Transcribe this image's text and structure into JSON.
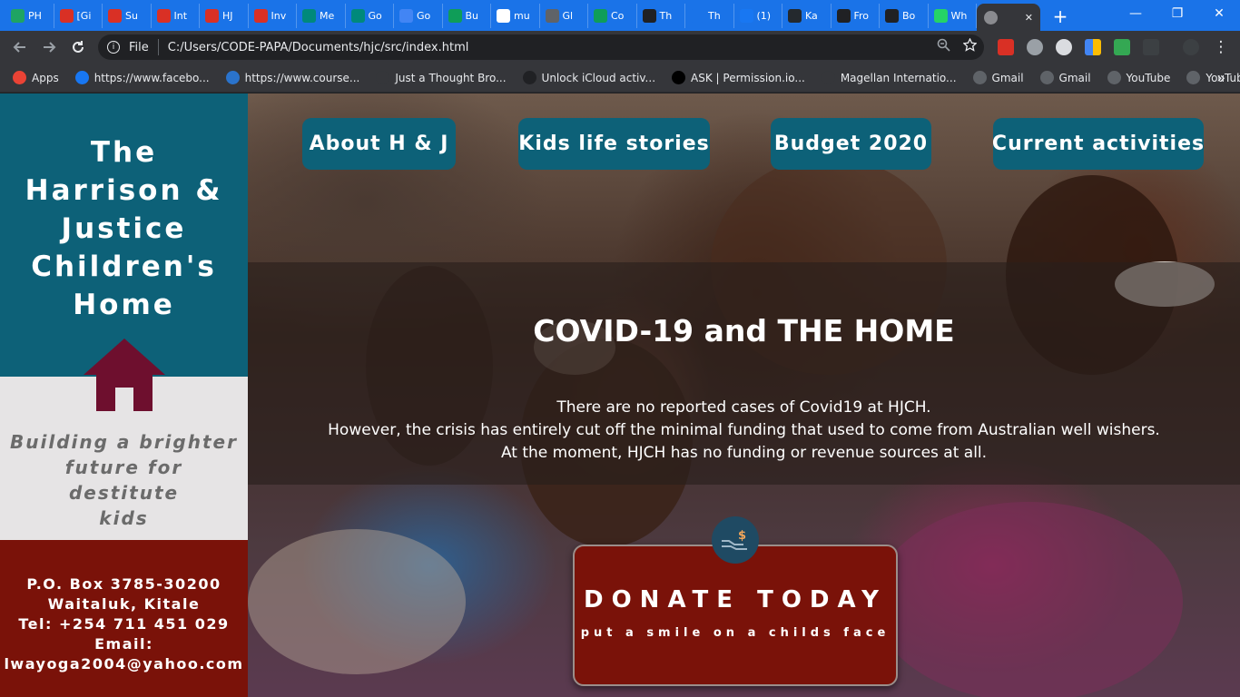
{
  "browser": {
    "tabs": [
      {
        "label": "PH",
        "icon": "sheets-icon",
        "color": "#1fa463"
      },
      {
        "label": "[Gi",
        "icon": "gmail-icon",
        "color": "#d93025"
      },
      {
        "label": "Su",
        "icon": "gmail-icon",
        "color": "#d93025"
      },
      {
        "label": "Int",
        "icon": "gmail-icon",
        "color": "#d93025"
      },
      {
        "label": "HJ",
        "icon": "gmail-icon",
        "color": "#d93025"
      },
      {
        "label": "Inv",
        "icon": "gmail-icon",
        "color": "#d93025"
      },
      {
        "label": "Me",
        "icon": "meet-icon",
        "color": "#00897b"
      },
      {
        "label": "Go",
        "icon": "meet-icon",
        "color": "#00897b"
      },
      {
        "label": "Go",
        "icon": "calendar-icon",
        "color": "#4285f4"
      },
      {
        "label": "Bu",
        "icon": "cross-icon",
        "color": "#0f9d58"
      },
      {
        "label": "mu",
        "icon": "google-icon",
        "color": "#ffffff"
      },
      {
        "label": "Gl",
        "icon": "bank-icon",
        "color": "#5f6368"
      },
      {
        "label": "Co",
        "icon": "cross-icon",
        "color": "#0f9d58"
      },
      {
        "label": "Th",
        "icon": "screen-icon",
        "color": "#202124"
      },
      {
        "label": "Th",
        "icon": "site-icon",
        "color": "#1a73e8"
      },
      {
        "label": "(1)",
        "icon": "facebook-icon",
        "color": "#1877f2"
      },
      {
        "label": "Ka",
        "icon": "github-icon",
        "color": "#24292e"
      },
      {
        "label": "Fro",
        "icon": "bolt-icon",
        "color": "#202124"
      },
      {
        "label": "Bo",
        "icon": "box-icon",
        "color": "#202124"
      },
      {
        "label": "Wh",
        "icon": "whatsapp-icon",
        "color": "#25d366"
      }
    ],
    "active_tab_close": "✕",
    "new_tab": "+",
    "window_buttons": {
      "minimize": "—",
      "maximize": "❐",
      "close": "✕"
    },
    "address": {
      "scheme": "File",
      "url": "C:/Users/CODE-PAPA/Documents/hjc/src/index.html"
    },
    "bookmarks": [
      {
        "label": "Apps",
        "icon": "apps-grid-icon",
        "color": "#ea4335"
      },
      {
        "label": "https://www.facebo...",
        "icon": "facebook-icon",
        "color": "#1877f2"
      },
      {
        "label": "https://www.course...",
        "icon": "coursera-icon",
        "color": "#2a73cc"
      },
      {
        "label": "Just a Thought Bro...",
        "icon": "blank-icon",
        "color": "#35363a"
      },
      {
        "label": "Unlock iCloud activ...",
        "icon": "apple-icon",
        "color": "#202124"
      },
      {
        "label": "ASK | Permission.io...",
        "icon": "p-icon",
        "color": "#000000"
      },
      {
        "label": "Magellan Internatio...",
        "icon": "magellan-icon",
        "color": "#35363a"
      },
      {
        "label": "Gmail",
        "icon": "globe-icon",
        "color": "#5f6368"
      },
      {
        "label": "Gmail",
        "icon": "globe-icon",
        "color": "#5f6368"
      },
      {
        "label": "YouTube",
        "icon": "globe-icon",
        "color": "#5f6368"
      },
      {
        "label": "YouTube",
        "icon": "globe-icon",
        "color": "#5f6368"
      }
    ],
    "bookmarks_more": "»"
  },
  "site": {
    "title_lines": [
      "The",
      "Harrison &",
      "Justice",
      "Children's",
      "Home"
    ],
    "tagline_lines": [
      "Building a brighter",
      "future for destitute",
      "kids"
    ],
    "contact_lines": [
      "P.O. Box 3785-30200",
      "Waitaluk, Kitale",
      "Tel: +254 711 451 029",
      "Email:",
      "lwayoga2004@yahoo.com"
    ],
    "colors": {
      "teal": "#0d6178",
      "maroon": "#7a1209",
      "home_icon": "#6e0f2e",
      "light": "#e6e4e5"
    }
  },
  "nav": {
    "about": "About H & J",
    "stories": "Kids life stories",
    "budget": "Budget 2020",
    "activities": "Current activities"
  },
  "banner": {
    "title": "COVID-19 and THE HOME",
    "lines": [
      "There are no reported cases of Covid19 at HJCH.",
      "However, the crisis has entirely cut off the minimal funding that used to come from Australian well wishers.",
      "At the moment, HJCH has no funding or revenue sources at all."
    ]
  },
  "donate": {
    "title": "DONATE TODAY",
    "subtitle": "put a smile on a childs face",
    "icon": "donation-hand-icon"
  }
}
